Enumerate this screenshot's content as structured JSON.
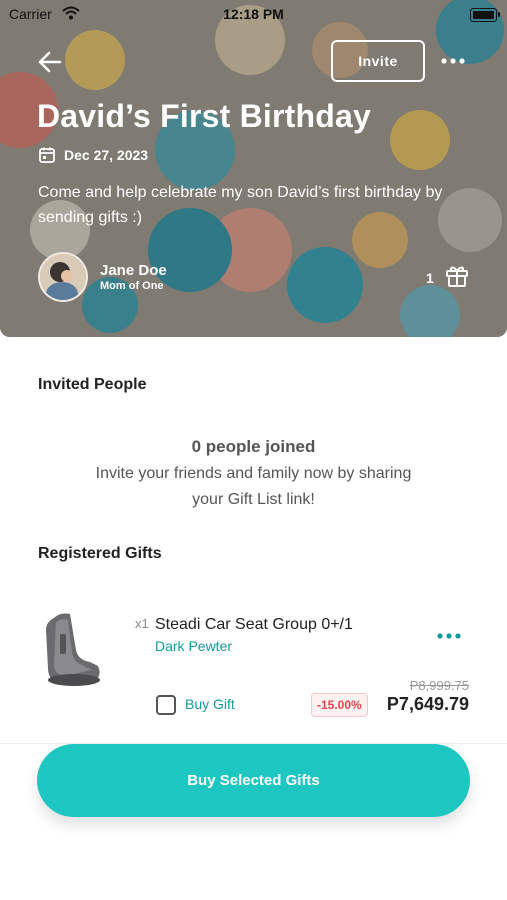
{
  "status_bar": {
    "carrier": "Carrier",
    "time": "12:18 PM"
  },
  "event": {
    "invite_label": "Invite",
    "title": "David’s First Birthday",
    "date": "Dec 27, 2023",
    "description": "Come and help celebrate my son David’s first birthday by sending gifts :)",
    "host_name": "Jane Doe",
    "host_role": "Mom of One",
    "gift_count": "1"
  },
  "invited": {
    "section_title": "Invited People",
    "empty_title": "0 people joined",
    "empty_subtitle": "Invite your friends and family now by sharing your Gift List link!"
  },
  "gifts": {
    "section_title": "Registered Gifts",
    "items": [
      {
        "qty": "x1",
        "name": "Steadi Car Seat Group 0+/1",
        "variant": "Dark Pewter",
        "buy_label": "Buy Gift",
        "discount": "-15.00%",
        "original_price": "P8,999.75",
        "price": "P7,649.79"
      }
    ]
  },
  "cta": {
    "label": "Buy Selected Gifts"
  },
  "colors": {
    "accent": "#1ec6c2",
    "variant_text": "#139c9a",
    "discount": "#e0454e"
  }
}
